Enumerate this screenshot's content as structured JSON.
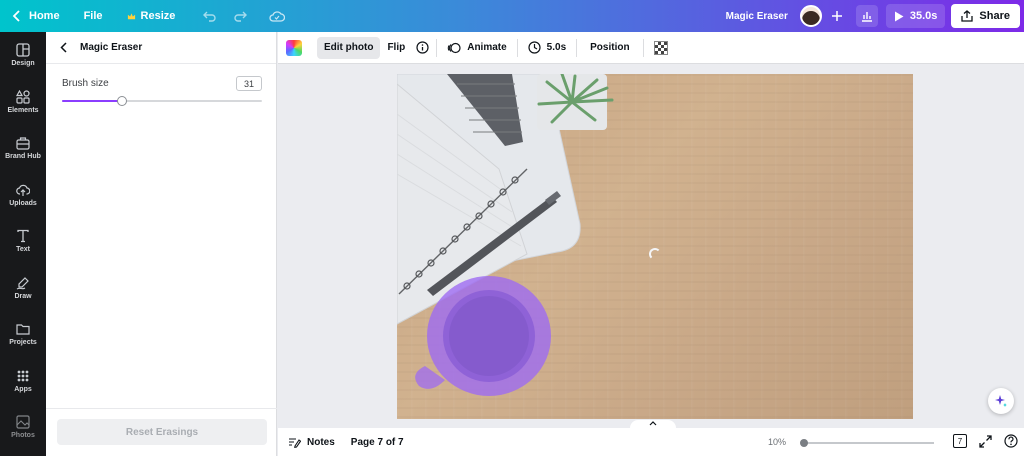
{
  "topbar": {
    "home_label": "Home",
    "file_label": "File",
    "resize_label": "Resize",
    "design_title": "Magic Eraser",
    "play_label": "35.0s",
    "share_label": "Share",
    "gradient_start": "#00c4cc",
    "gradient_end": "#7d2ae8"
  },
  "rail": {
    "items": [
      {
        "label": "Design",
        "icon": "design-icon"
      },
      {
        "label": "Elements",
        "icon": "elements-icon"
      },
      {
        "label": "Brand Hub",
        "icon": "brand-hub-icon"
      },
      {
        "label": "Uploads",
        "icon": "uploads-icon"
      },
      {
        "label": "Text",
        "icon": "text-icon"
      },
      {
        "label": "Draw",
        "icon": "draw-icon"
      },
      {
        "label": "Projects",
        "icon": "projects-icon"
      },
      {
        "label": "Apps",
        "icon": "apps-icon"
      },
      {
        "label": "Photos",
        "icon": "photos-icon"
      }
    ]
  },
  "panel": {
    "title": "Magic Eraser",
    "brush_label": "Brush size",
    "brush_value": "31",
    "brush_fraction": 0.3,
    "reset_label": "Reset Erasings",
    "accent": "#8b3dff"
  },
  "toolbar": {
    "edit_photo_label": "Edit photo",
    "flip_label": "Flip",
    "animate_label": "Animate",
    "duration_label": "5.0s",
    "position_label": "Position"
  },
  "bottombar": {
    "notes_label": "Notes",
    "page_label": "Page 7 of 7",
    "zoom_label": "10%",
    "zoom_fraction": 0.0,
    "page_count": "7"
  }
}
